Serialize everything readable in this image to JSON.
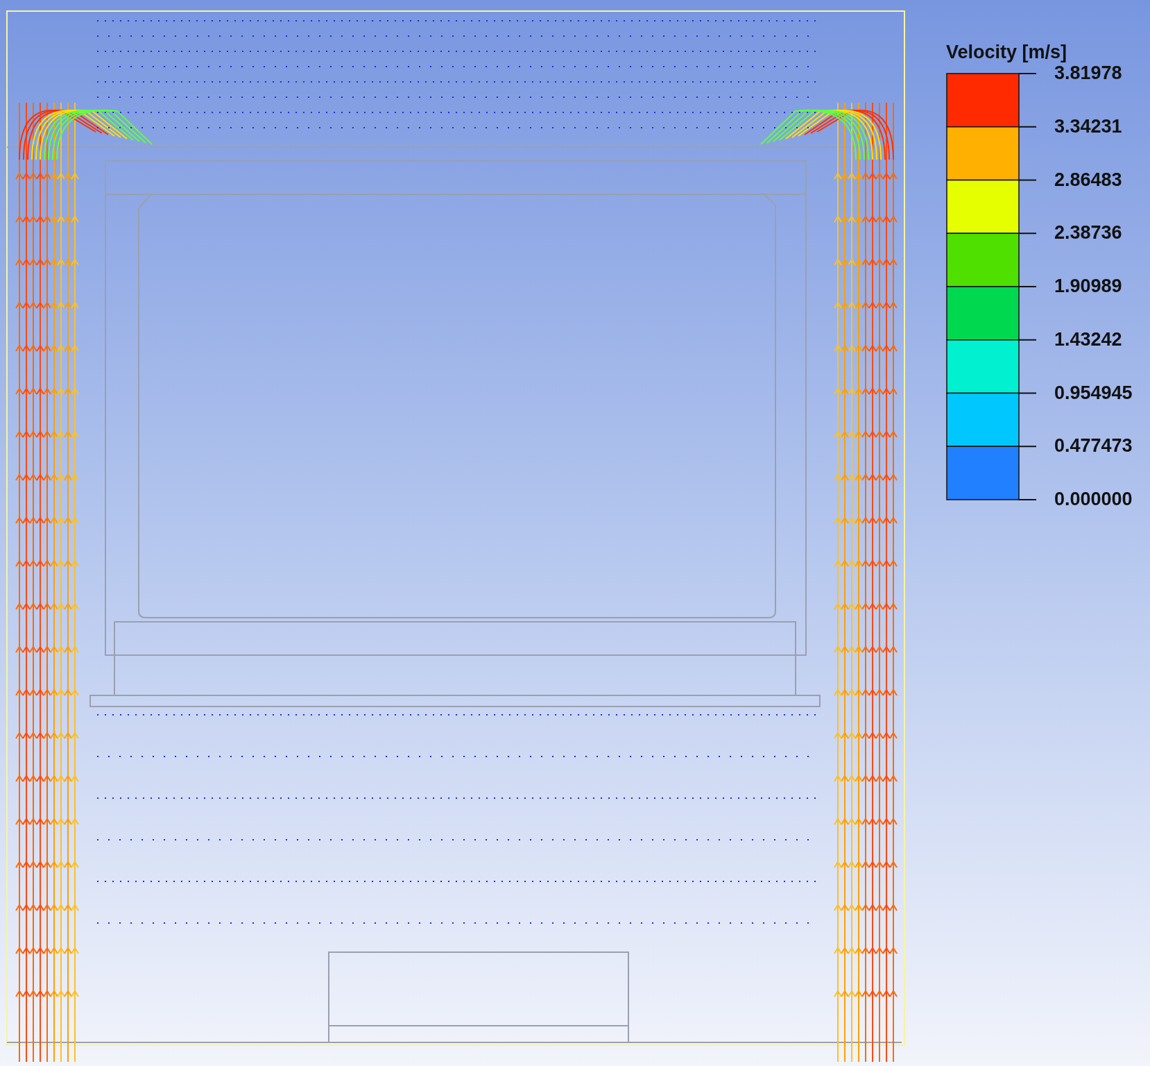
{
  "legend": {
    "title": "Velocity [m/s]",
    "ticks": [
      "3.81978",
      "3.34231",
      "2.86483",
      "2.38736",
      "1.90989",
      "1.43242",
      "0.954945",
      "0.477473",
      "0.000000"
    ]
  }
}
